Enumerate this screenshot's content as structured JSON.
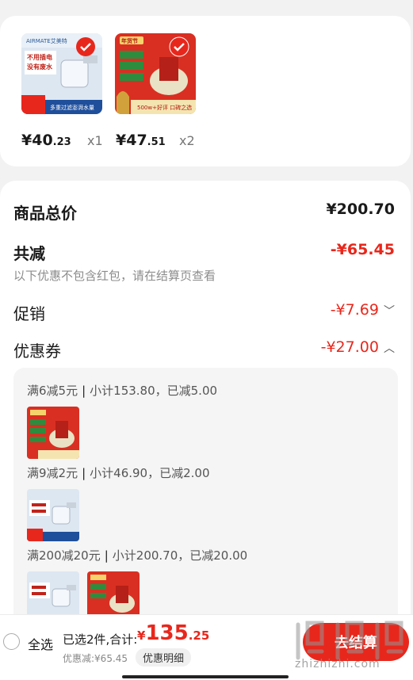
{
  "products": [
    {
      "price_int": "¥40",
      "price_dec": ".23",
      "qty": "x1",
      "image": "water-filter-faucet",
      "img_brand": "AIRMATE艾美特",
      "img_tag1": "不用插电",
      "img_tag2": "没有废水",
      "img_bottom": "多重过滤澎湃水量"
    },
    {
      "price_int": "¥47",
      "price_dec": ".51",
      "qty": "x2",
      "image": "zongzi-gift-box",
      "img_brand": "年货节",
      "img_bottom": "500w+好评 口碑之选"
    }
  ],
  "summary": {
    "goods_total_label": "商品总价",
    "goods_total_value": "¥200.70",
    "reduce_label": "共减",
    "reduce_value": "-¥65.45",
    "note": "以下优惠不包含红包，请在结算页查看",
    "promo_label": "促销",
    "promo_value": "-¥7.69",
    "coupon_label": "优惠券",
    "coupon_value": "-¥27.00"
  },
  "coupon_rules": [
    {
      "rule": "满6减5元",
      "detail": "小计153.80，已减5.00"
    },
    {
      "rule": "满9减2元",
      "detail": "小计46.90，已减2.00"
    },
    {
      "rule": "满200减20元",
      "detail": "小计200.70，已减20.00"
    }
  ],
  "bottom": {
    "select_all": "全选",
    "selected": "已选2件,合计:",
    "total_symbol": "¥",
    "total_int": "135",
    "total_dec": ".25",
    "discount": "优惠减:¥65.45",
    "detail_btn": "优惠明细",
    "checkout": "去结算"
  },
  "watermark": {
    "text": "zhizhizhi.com"
  },
  "colors": {
    "accent": "#e8271c",
    "background": "#f2f2f2"
  }
}
